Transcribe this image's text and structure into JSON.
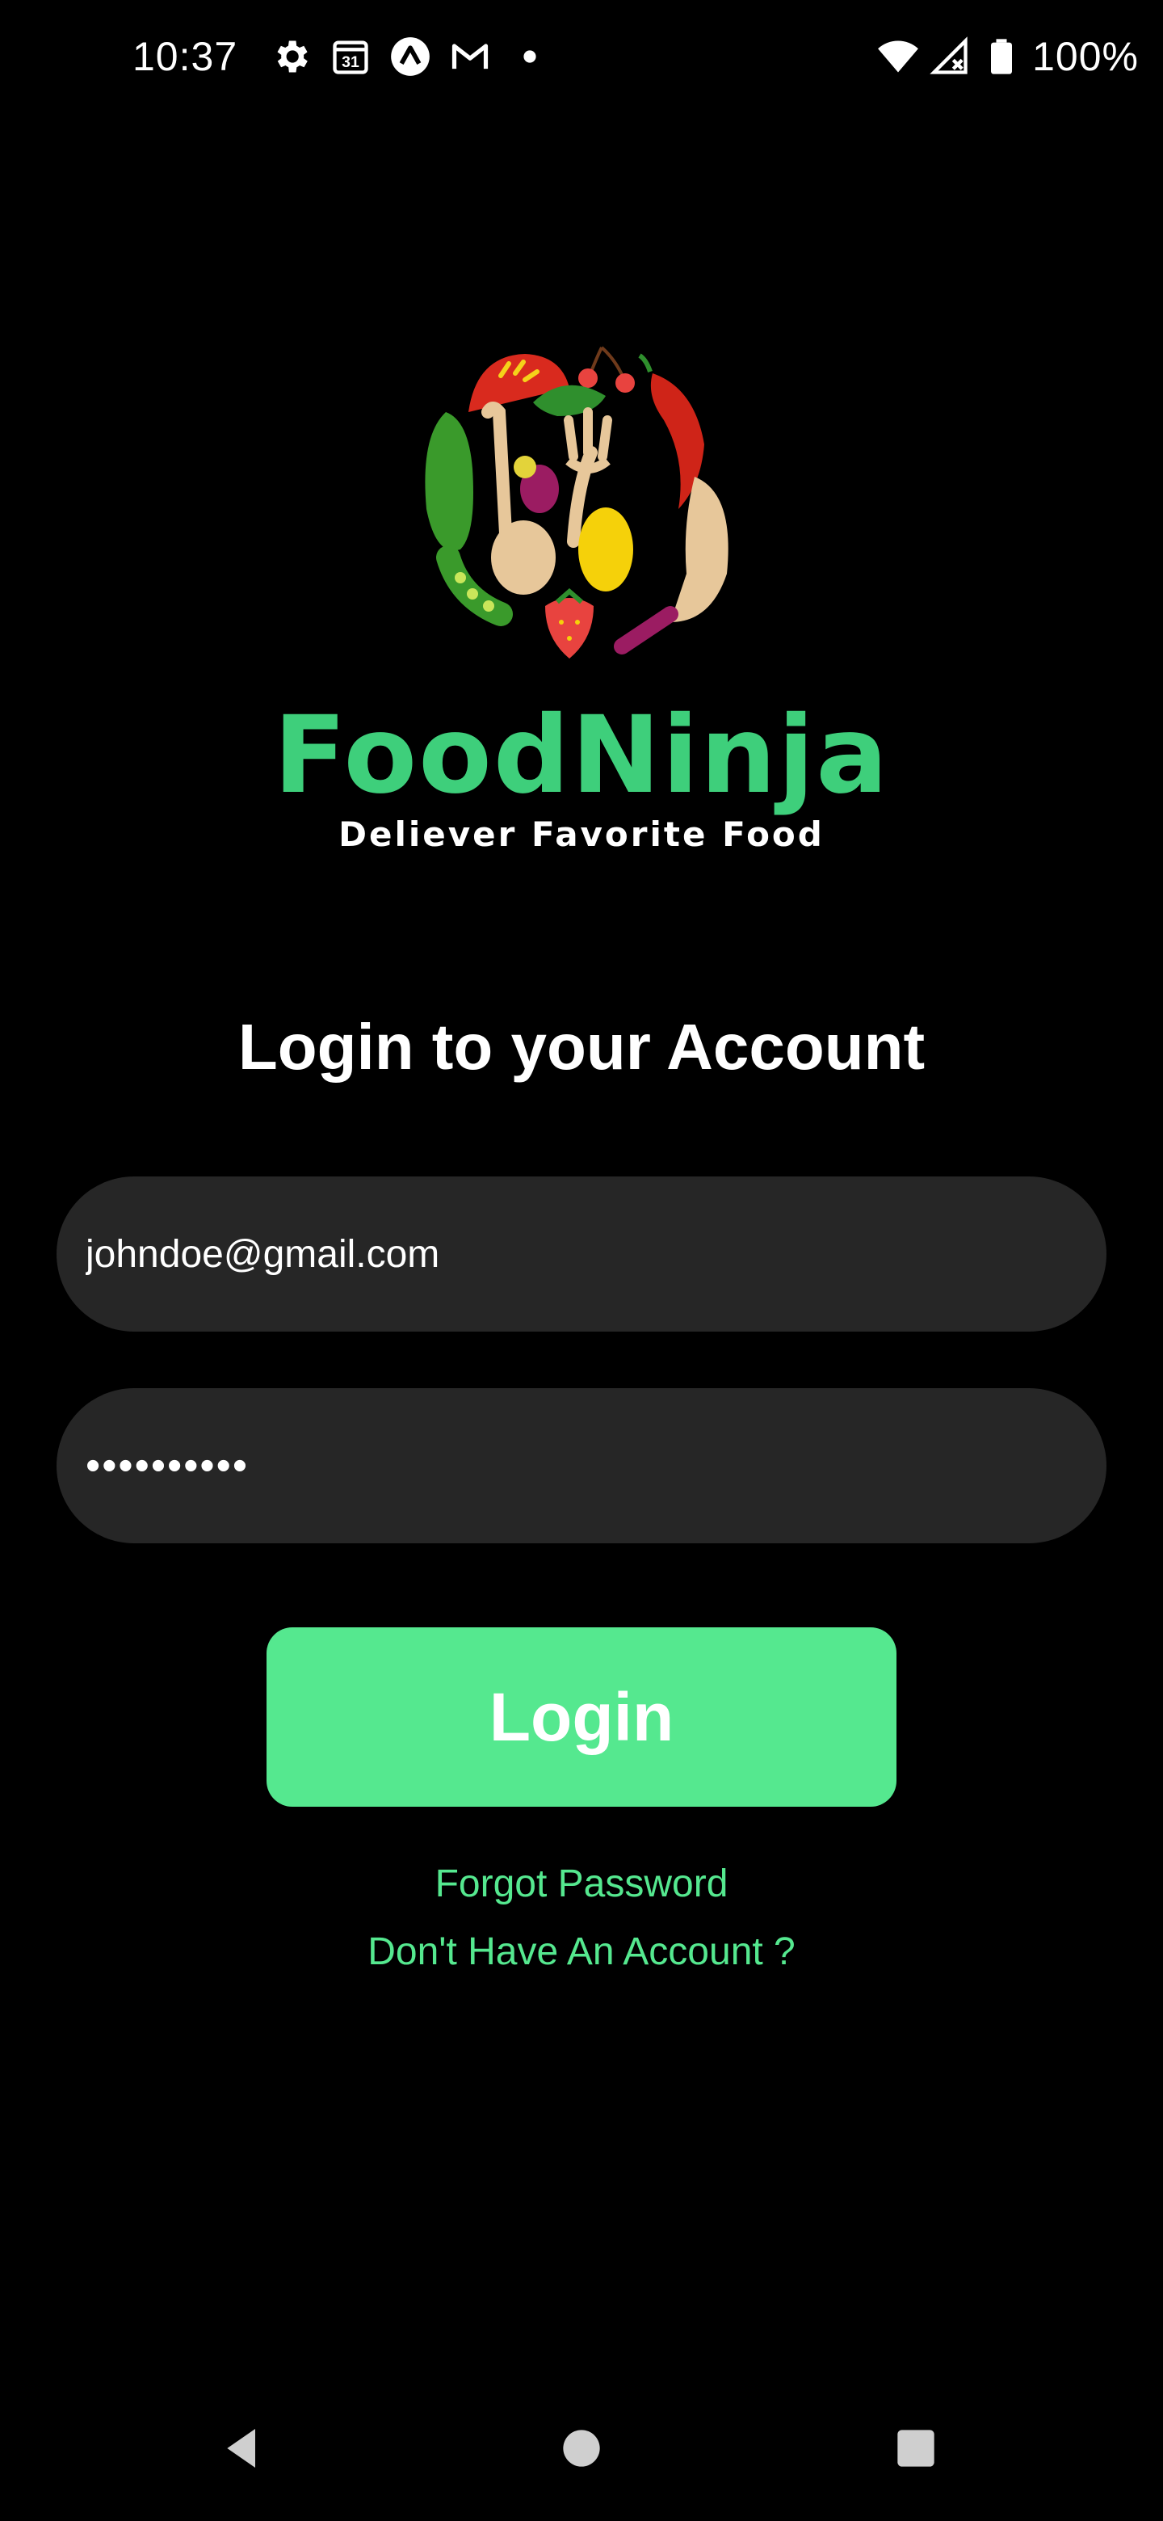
{
  "status_bar": {
    "time": "10:37",
    "calendar_day": "31",
    "battery": "100%",
    "icons": [
      "settings-icon",
      "calendar-icon",
      "arc-icon",
      "gmail-icon",
      "notification-dot-icon",
      "wifi-icon",
      "signal-icon",
      "battery-icon"
    ]
  },
  "brand": {
    "name": "FoodNinja",
    "tagline": "Deliever Favorite Food"
  },
  "login": {
    "title": "Login to your Account",
    "email_value": "johndoe@gmail.com",
    "password_masked": "••••••••••",
    "button_label": "Login",
    "forgot_link": "Forgot Password",
    "signup_link": "Don't Have An Account ?"
  },
  "colors": {
    "accent": "#55e88f",
    "brand_green": "#3ecf7b",
    "field_bg": "#262626",
    "background": "#000000"
  },
  "nav_bar": {
    "icons": [
      "back-icon",
      "home-icon",
      "recents-icon"
    ]
  }
}
